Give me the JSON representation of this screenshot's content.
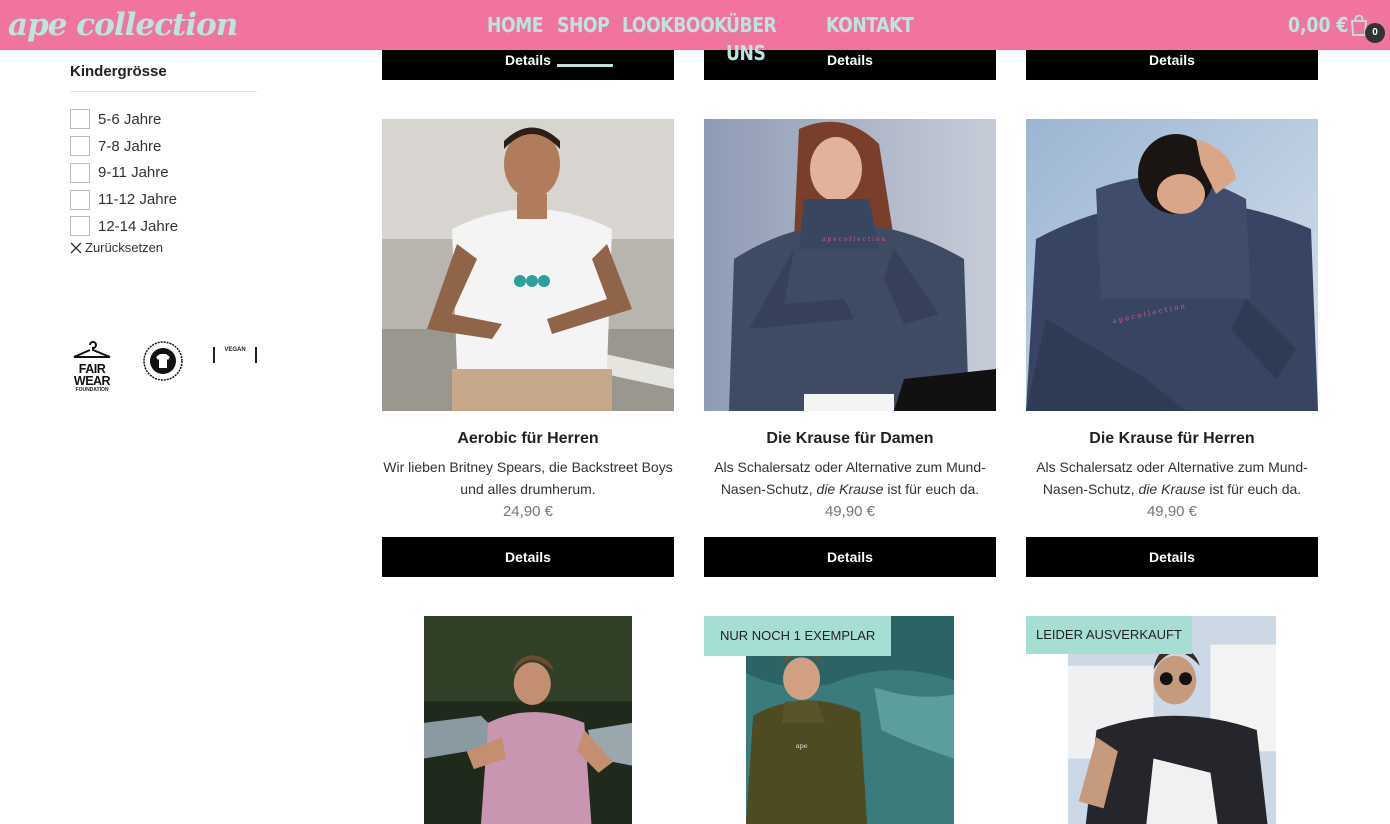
{
  "header": {
    "logo": "ape collection",
    "nav": [
      {
        "label": "HOME"
      },
      {
        "label": "SHOP"
      },
      {
        "label": "LOOKBOOK"
      },
      {
        "label": "ÜBER UNS"
      },
      {
        "label": "KONTAKT"
      }
    ],
    "cart_total": "0,00 €",
    "cart_count": "0"
  },
  "sidebar": {
    "filter_title": "Kindergrösse",
    "options": [
      "5-6 Jahre",
      "7-8 Jahre",
      "9-11 Jahre",
      "11-12 Jahre",
      "12-14 Jahre"
    ],
    "reset_label": "Zurücksetzen",
    "badges": {
      "fairwear": [
        "FAIR",
        "WEAR",
        "FOUNDATION"
      ],
      "vegan": "VEGAN"
    }
  },
  "products": {
    "details_label": "Details",
    "row1": [
      {
        "title": "Aerobic für Herren",
        "desc_a": "Wir lieben Britney Spears, die Backstreet Boys und alles drumherum.",
        "desc_em": "",
        "desc_b": "",
        "price": "24,90 €"
      },
      {
        "title": "Die Krause für Damen",
        "desc_a": "Als Schalersatz oder Alternative zum Mund-Nasen-Schutz, ",
        "desc_em": "die Krause",
        "desc_b": " ist für euch da.",
        "price": "49,90 €"
      },
      {
        "title": "Die Krause für Herren",
        "desc_a": "Als Schalersatz oder Alternative zum Mund-Nasen-Schutz, ",
        "desc_em": "die Krause",
        "desc_b": " ist für euch da.",
        "price": "49,90 €"
      }
    ],
    "row2_ribbons": [
      "NUR NOCH 1 EXEMPLAR",
      "LEIDER AUSVERKAUFT"
    ]
  },
  "colors": {
    "header_bg": "#f0749e",
    "header_text": "#b9e7df",
    "ribbon_bg": "#a7ded3",
    "button_bg": "#000000"
  }
}
